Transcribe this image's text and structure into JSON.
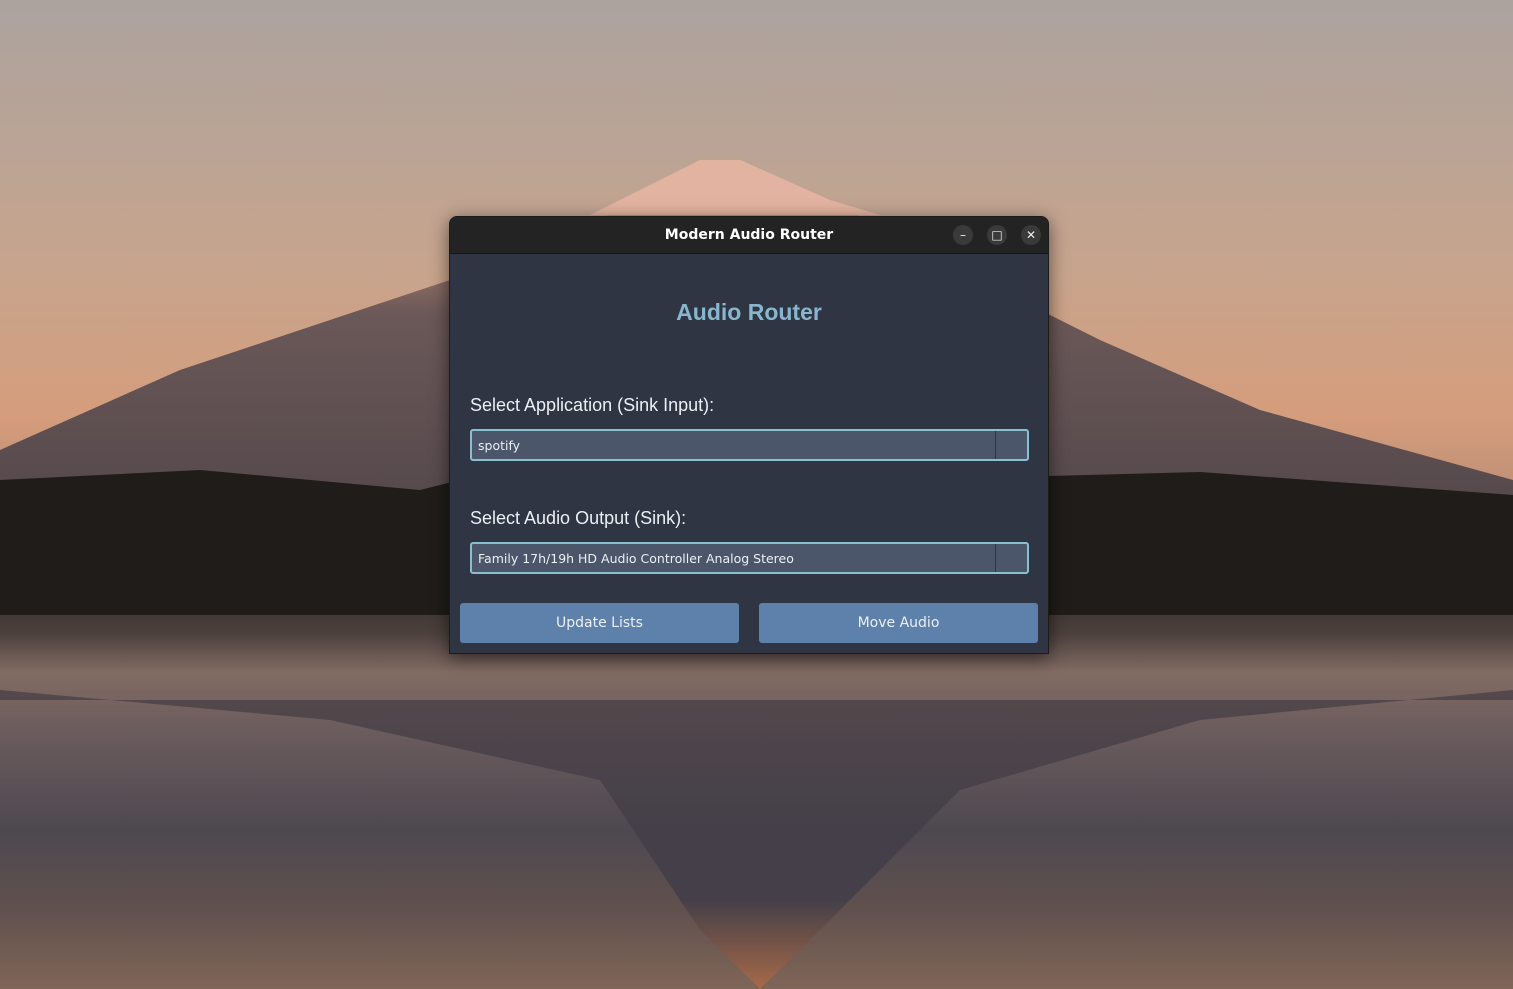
{
  "window": {
    "title": "Modern Audio Router",
    "minimize_glyph": "–",
    "maximize_glyph": "□",
    "close_glyph": "✕"
  },
  "app": {
    "heading": "Audio Router",
    "application_label": "Select Application (Sink Input):",
    "application_value": "spotify",
    "output_label": "Select Audio Output (Sink):",
    "output_value": "Family 17h/19h HD Audio Controller Analog Stereo",
    "update_button": "Update Lists",
    "move_button": "Move Audio"
  },
  "colors": {
    "heading": "#88b7cd",
    "window_bg": "#2f3542",
    "combo_bg": "#4c566a",
    "combo_border": "#88c0d0",
    "button_bg": "#5e81ac",
    "titlebar": "#232323"
  },
  "icons": {
    "minimize": "minimize-icon",
    "maximize": "maximize-icon",
    "close": "close-icon"
  }
}
